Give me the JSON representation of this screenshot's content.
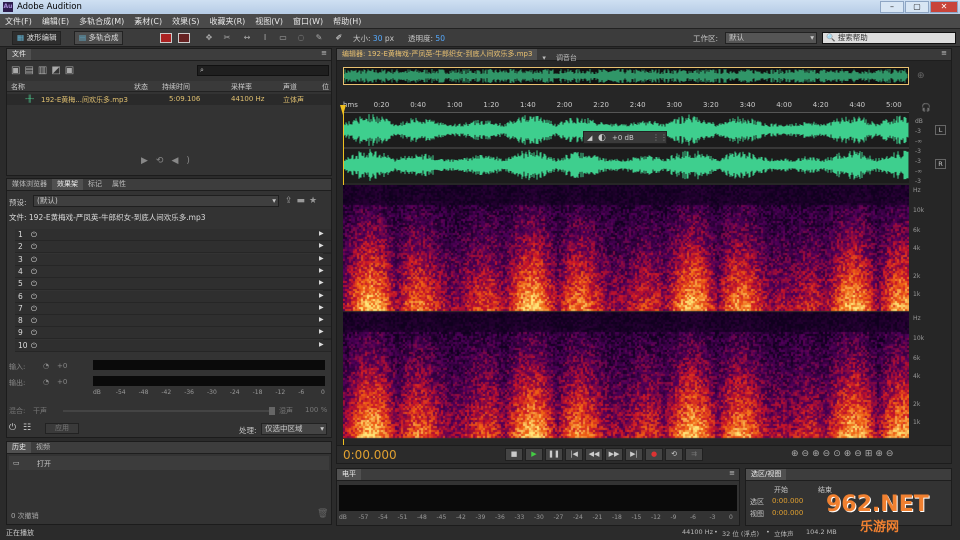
{
  "app": {
    "logo": "Au",
    "title": "Adobe Audition",
    "win_min": "–",
    "win_max": "▢",
    "win_close": "✕"
  },
  "menu": [
    "文件(F)",
    "编辑(E)",
    "多轨合成(M)",
    "素材(C)",
    "效果(S)",
    "收藏夹(R)",
    "视图(V)",
    "窗口(W)",
    "帮助(H)"
  ],
  "toolbar": {
    "waveform_label": "波形编辑",
    "multitrack_label": "多轨合成",
    "size_label": "大小:",
    "size_value": "30",
    "size_unit": "px",
    "opacity_label": "透明度:",
    "opacity_value": "50",
    "workspace_label": "工作区:",
    "workspace_value": "默认",
    "search_placeholder": "搜索帮助"
  },
  "files_panel": {
    "tab": "文件",
    "columns": [
      "名称",
      "状态",
      "持续时间",
      "采样率",
      "声道",
      "位"
    ],
    "file": {
      "name": "192-E黄梅...间欢乐多.mp3",
      "duration": "5:09.106",
      "sample_rate": "44100 Hz",
      "channels": "立体声"
    }
  },
  "effects_panel": {
    "tabs": [
      "媒体浏览器",
      "效果架",
      "标记",
      "属性"
    ],
    "preset_label": "预设:",
    "preset_value": "(默认)",
    "file_label": "文件: 192-E黄梅戏-严凤英-牛郎织女-到底人间欢乐多.mp3",
    "slots": [
      "1",
      "2",
      "3",
      "4",
      "5",
      "6",
      "7",
      "8",
      "9",
      "10"
    ],
    "input_label": "输入:",
    "output_label": "输出:",
    "input_db": "+0",
    "output_db": "+0",
    "meter_scale": [
      "dB",
      "-54",
      "-48",
      "-42",
      "-36",
      "-30",
      "-24",
      "-18",
      "-12",
      "-6",
      "0"
    ],
    "mix_label": "混合:",
    "mix_dry": "干声",
    "mix_wet": "湿声",
    "mix_value": "100 %",
    "apply_label": "应用",
    "process_label": "处理:",
    "process_value": "仅选中区域"
  },
  "history_panel": {
    "tabs": [
      "历史",
      "视频"
    ],
    "item": "打开",
    "undo_count": "0 次撤销"
  },
  "status_left": "正在播放",
  "editor": {
    "tab_label": "编辑器: 192-E黄梅戏-严凤英-牛郎织女-到底人间欢乐多.mp3",
    "mixer_tab": "调音台",
    "time_labels": [
      "hms",
      "0:20",
      "0:40",
      "1:00",
      "1:20",
      "1:40",
      "2:00",
      "2:20",
      "2:40",
      "3:00",
      "3:20",
      "3:40",
      "4:00",
      "4:20",
      "4:40",
      "5:00"
    ],
    "hud_db": "+0 dB",
    "wave_db_scale": [
      "dB",
      "-3",
      "-∞",
      "-3"
    ],
    "channel_left": "L",
    "channel_right": "R",
    "hz_scale": [
      "Hz",
      "10k",
      "6k",
      "4k",
      "2k",
      "1k"
    ],
    "current_time": "0:00.000"
  },
  "levels_panel": {
    "tab": "电平",
    "scale": [
      "dB",
      "-57",
      "-54",
      "-51",
      "-48",
      "-45",
      "-42",
      "-39",
      "-36",
      "-33",
      "-30",
      "-27",
      "-24",
      "-21",
      "-18",
      "-15",
      "-12",
      "-9",
      "-6",
      "-3",
      "0"
    ]
  },
  "selection_panel": {
    "tab": "选区/视图",
    "start_header": "开始",
    "end_header": "结束",
    "selection_label": "选区",
    "view_label": "视图",
    "selection_start": "0:00.000",
    "view_start": "0:00.000"
  },
  "status_right": {
    "sample": "44100 Hz",
    "bits": "32 位 (浮点)",
    "channels": "立体声",
    "size": "104.2 MB"
  },
  "watermark": {
    "site": "962.NET",
    "sub": "乐游网"
  },
  "colors": {
    "waveform": "#3ecf8e",
    "playhead": "#f0c020",
    "time_readout": "#e0a030",
    "spectro_hot": "#ffe07a",
    "spectro_cold": "#1a0030"
  }
}
